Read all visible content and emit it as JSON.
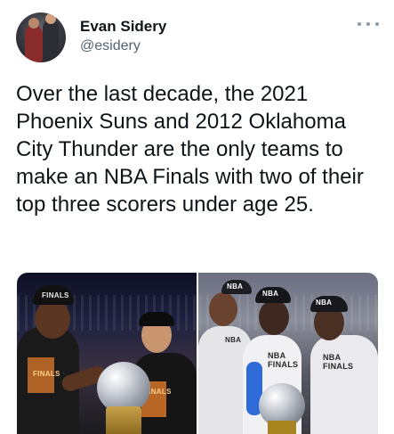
{
  "tweet": {
    "author": {
      "display_name": "Evan Sidery",
      "handle": "@esidery"
    },
    "more_icon": "more-horizontal-icon",
    "text": "Over the last decade, the 2021 Phoenix Suns and 2012 Oklahoma City Thunder are the only teams to make an NBA Finals with two of their top three scorers under age 25.",
    "media": {
      "left_photo_labels": {
        "cap_left": "FINALS",
        "shirt_left": "FINALS",
        "shirt_right": "FINALS"
      },
      "right_photo_labels": {
        "cap_a": "NBA",
        "shirt_a": "NBA",
        "shirt_b": "NBA FINALS",
        "cap_b": "NBA",
        "shirt_c": "NBA FINALS",
        "cap_c": "NBA"
      }
    }
  },
  "colors": {
    "text_primary": "#0f1419",
    "text_secondary": "#536471",
    "suns_orange": "#e07b2a",
    "thunder_blue": "#2f6bd8"
  }
}
